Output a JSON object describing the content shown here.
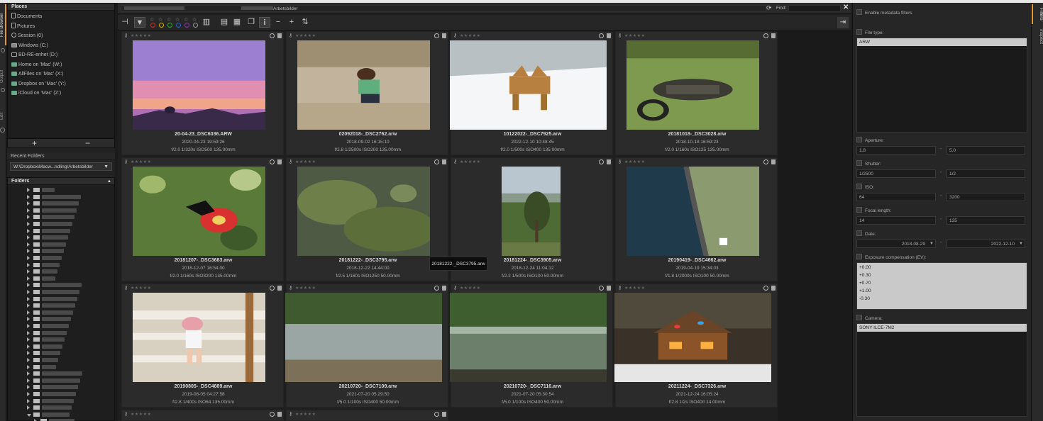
{
  "window": {
    "path_text": "Arbetsbilder",
    "find_label": "Find:",
    "close_glyph": "✕",
    "refresh_glyph": "⟳"
  },
  "left_tabs": [
    "File Browser",
    "Output",
    "Edit"
  ],
  "places": {
    "header": "Places",
    "items": [
      {
        "label": "Documents",
        "icon": "document-icon"
      },
      {
        "label": "Pictures",
        "icon": "document-icon"
      },
      {
        "label": "Session (0)",
        "icon": "clock-icon"
      },
      {
        "label": "Windows (C:)",
        "icon": "drive-icon"
      },
      {
        "label": "BD-RE-enhet (D:)",
        "icon": "optical-drive-icon"
      },
      {
        "label": "Home on 'Mac' (W:)",
        "icon": "network-drive-icon"
      },
      {
        "label": "AllFiles on 'Mac' (X:)",
        "icon": "network-drive-icon"
      },
      {
        "label": "Dropbox on 'Mac' (Y:)",
        "icon": "network-drive-icon"
      },
      {
        "label": "iCloud on 'Mac' (Z:)",
        "icon": "network-drive-icon"
      }
    ],
    "add_glyph": "+",
    "remove_glyph": "−"
  },
  "recent": {
    "header": "Recent Folders",
    "value": "W:\\Dropbox\\Macw...ndling\\Arbetsbilder"
  },
  "folders": {
    "header": "Folders"
  },
  "toolbar": {
    "info_glyph": "i",
    "zoom_out_glyph": "−",
    "zoom_in_glyph": "+",
    "sort_glyph": "⇅",
    "star_glyph": "☆"
  },
  "colors": {
    "accent": "#e39b2f",
    "label_red": "#c0392b",
    "label_yellow": "#d4b106",
    "label_green": "#3aa33a",
    "label_blue": "#3060c0",
    "label_purple": "#8a3aa0"
  },
  "thumbnails": [
    {
      "name": "20-04-23_DSC6036.ARW",
      "date": "2020-04-23 19:59:26",
      "exif": "f/2.0 1/320s ISO500 135.00mm",
      "icon": "sunset-photo"
    },
    {
      "name": "02092018-_DSC2762.arw",
      "date": "2018-09-02 16:15:10",
      "exif": "f/2.8 1/2500s ISO200 135.00mm",
      "icon": "child-beach-photo"
    },
    {
      "name": "10122022-_DSC7925.arw",
      "date": "2022-12-10 10:48:45",
      "exif": "f/2.0 1/500s ISO400 135.00mm",
      "icon": "dog-snow-photo"
    },
    {
      "name": "20181018-_DSC3028.arw",
      "date": "2018-10-18 16:59:23",
      "exif": "f/2.0 1/160s ISO125 135.00mm",
      "icon": "burnt-bike-photo"
    },
    {
      "name": "20181207-_DSC3683.arw",
      "date": "2018-12-07 16:54:00",
      "exif": "f/2.0 1/160s ISO3200 135.00mm",
      "icon": "butterfly-photo"
    },
    {
      "name": "20181222-_DSC3795.arw",
      "date": "2018-12-22 14:44:00",
      "exif": "f/2.5 1/160s ISO1250 50.00mm",
      "icon": "moss-photo"
    },
    {
      "name": "20181224-_DSC3905.arw",
      "date": "2018-12-24 11:04:12",
      "exif": "f/2.2 1/500s ISO100 50.00mm",
      "icon": "tree-photo"
    },
    {
      "name": "20190419-_DSC4662.arw",
      "date": "2019-04-19 15:34:03",
      "exif": "f/1.8 1/2000s ISO100 50.00mm",
      "icon": "river-photo"
    },
    {
      "name": "20190805-_DSC4889.arw",
      "date": "2019-08-05 04:27:58",
      "exif": "f/2.8 1/400s ISO64 135.00mm",
      "icon": "toddler-photo"
    },
    {
      "name": "20210720-_DSC7109.arw",
      "date": "2021-07-20 05:29:50",
      "exif": "f/5.0 1/100s ISO400 50.00mm",
      "icon": "lake-mist-photo"
    },
    {
      "name": "20210720-_DSC7116.arw",
      "date": "2021-07-20 05:30:54",
      "exif": "f/5.0 1/100s ISO400 50.00mm",
      "icon": "lake-reflection-photo"
    },
    {
      "name": "20211224-_DSC7326.arw",
      "date": "2021-12-24 16:05:24",
      "exif": "f/2.8 1/2s ISO400 14.00mm",
      "icon": "gingerbread-photo"
    }
  ],
  "tooltip": "20181222-_DSC3795.arw",
  "filters": {
    "enable": "Enable metadata filters",
    "file_type": {
      "label": "File type:",
      "items": [
        "ARW"
      ]
    },
    "aperture": {
      "label": "Aperture:",
      "min": "1.8",
      "max": "5.0"
    },
    "shutter": {
      "label": "Shutter:",
      "min": "1/2500",
      "max": "1/2"
    },
    "iso": {
      "label": "ISO:",
      "min": "64",
      "max": "3200"
    },
    "focal": {
      "label": "Focal length:",
      "min": "14",
      "max": "135"
    },
    "date": {
      "label": "Date:",
      "min": "2018-08-29",
      "max": "2022-12-10"
    },
    "exposure": {
      "label": "Exposure compensation (EV):",
      "items": [
        "+0.00",
        "+0.30",
        "+0.70",
        "+1.00",
        "-0.30"
      ]
    },
    "camera": {
      "label": "Camera:",
      "items": [
        "SONY ILCE-7M2"
      ]
    },
    "dash": "-"
  },
  "right_tabs": [
    "Filters",
    "Inspect"
  ]
}
